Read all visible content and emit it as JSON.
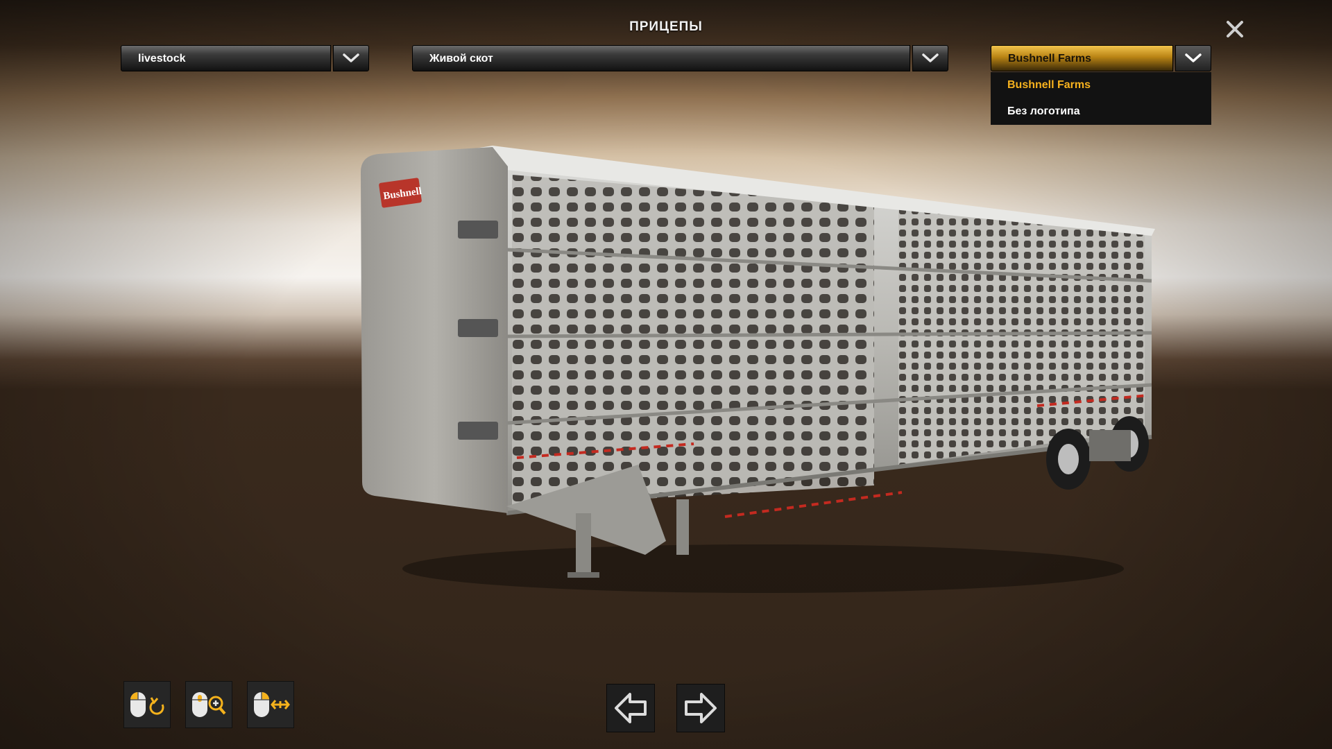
{
  "header": {
    "title": "ПРИЦЕПЫ"
  },
  "dropdowns": {
    "type": {
      "value": "livestock"
    },
    "cargo": {
      "value": "Живой скот"
    },
    "logo": {
      "value": "Bushnell Farms",
      "options": [
        "Bushnell Farms",
        "Без логотипа"
      ]
    }
  },
  "trailer": {
    "logo_text": "Bushnell"
  },
  "colors": {
    "accent": "#f7b21e",
    "panel": "#121212"
  },
  "icons": {
    "close": "close-icon",
    "arrow": "chevron-down-icon",
    "rotate": "mouse-rotate-icon",
    "zoom": "mouse-zoom-icon",
    "pan": "mouse-pan-icon",
    "prev": "arrow-left-icon",
    "next": "arrow-right-icon"
  }
}
